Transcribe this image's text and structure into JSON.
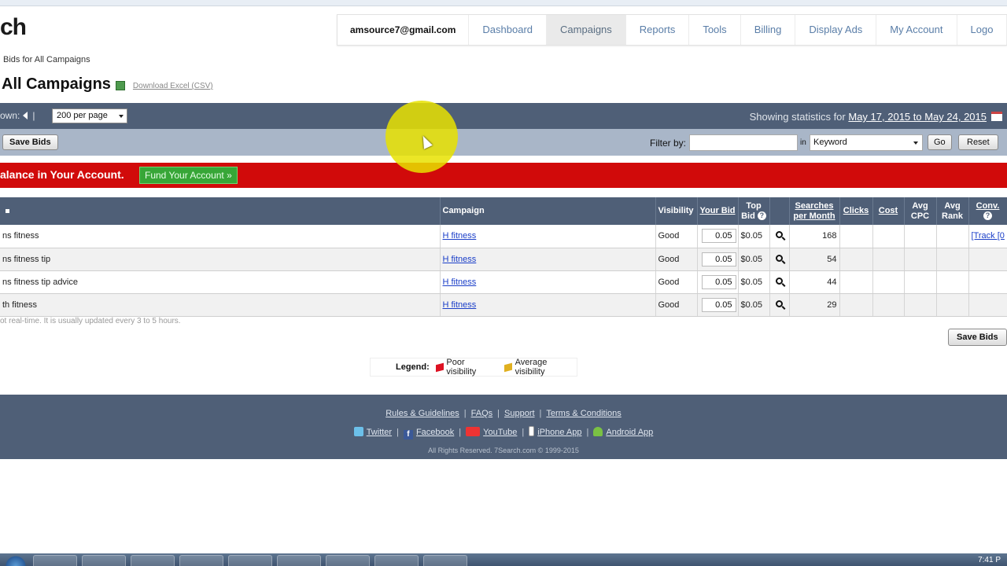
{
  "logo": {
    "text": "ch"
  },
  "nav": {
    "email": "amsource7@gmail.com",
    "items": [
      {
        "label": "Dashboard",
        "active": false
      },
      {
        "label": "Campaigns",
        "active": true
      },
      {
        "label": "Reports",
        "active": false
      },
      {
        "label": "Tools",
        "active": false
      },
      {
        "label": "Billing",
        "active": false
      },
      {
        "label": "Display Ads",
        "active": false
      },
      {
        "label": "My Account",
        "active": false
      },
      {
        "label": "Logo",
        "active": false
      }
    ]
  },
  "breadcrumb": "Bids for All Campaigns",
  "page": {
    "title": "All Campaigns",
    "download_label": "Download Excel (CSV)"
  },
  "toolbar": {
    "shown_label": "own:",
    "per_page": "200 per page",
    "stats_prefix": "Showing statistics for",
    "date_range": "May 17, 2015 to May 24, 2015",
    "save_bids": "Save Bids",
    "filter_label": "Filter by:",
    "filter_value": "",
    "in_label": "in",
    "filter_field": "Keyword",
    "go": "Go",
    "reset": "Reset"
  },
  "alert": {
    "message": "alance in Your Account.",
    "fund_button": "Fund Your Account »"
  },
  "table": {
    "headers": {
      "keyword": "",
      "campaign": "Campaign",
      "visibility": "Visibility",
      "your_bid": "Your Bid",
      "top_bid": "Top Bid",
      "searches": "Searches per Month",
      "clicks": "Clicks",
      "cost": "Cost",
      "avg_cpc": "Avg CPC",
      "avg_rank": "Avg Rank",
      "conv": "Conv."
    },
    "rows": [
      {
        "keyword": "ns fitness",
        "campaign": "H fitness",
        "visibility": "Good",
        "your_bid": "0.05",
        "top_bid": "$0.05",
        "searches": "168",
        "clicks": "",
        "cost": "",
        "avg_cpc": "",
        "avg_rank": "",
        "conv": "[Track [0"
      },
      {
        "keyword": "ns fitness tip",
        "campaign": "H fitness",
        "visibility": "Good",
        "your_bid": "0.05",
        "top_bid": "$0.05",
        "searches": "54",
        "clicks": "",
        "cost": "",
        "avg_cpc": "",
        "avg_rank": "",
        "conv": ""
      },
      {
        "keyword": "ns fitness tip advice",
        "campaign": "H fitness",
        "visibility": "Good",
        "your_bid": "0.05",
        "top_bid": "$0.05",
        "searches": "44",
        "clicks": "",
        "cost": "",
        "avg_cpc": "",
        "avg_rank": "",
        "conv": ""
      },
      {
        "keyword": "th fitness",
        "campaign": "H fitness",
        "visibility": "Good",
        "your_bid": "0.05",
        "top_bid": "$0.05",
        "searches": "29",
        "clicks": "",
        "cost": "",
        "avg_cpc": "",
        "avg_rank": "",
        "conv": ""
      }
    ]
  },
  "note": "ot real-time. It is usually updated every 3 to 5 hours.",
  "save_bids_bottom": "Save Bids",
  "legend": {
    "title": "Legend:",
    "poor": "Poor visibility",
    "average": "Average visibility"
  },
  "footer": {
    "links": [
      "Rules & Guidelines",
      "FAQs",
      "Support",
      "Terms & Conditions"
    ],
    "social": [
      "Twitter",
      "Facebook",
      "YouTube",
      "iPhone App",
      "Android App"
    ],
    "copyright": "All Rights Reserved. 7Search.com © 1999-2015"
  },
  "taskbar": {
    "clock": "7:41 P"
  },
  "colors": {
    "header_bar": "#4f5f77",
    "filter_bar": "#a9b6c8",
    "alert_red": "#d10a0a",
    "fund_green": "#37a637",
    "link_blue": "#1a3ec8",
    "cursor_highlight": "#e8e200"
  }
}
